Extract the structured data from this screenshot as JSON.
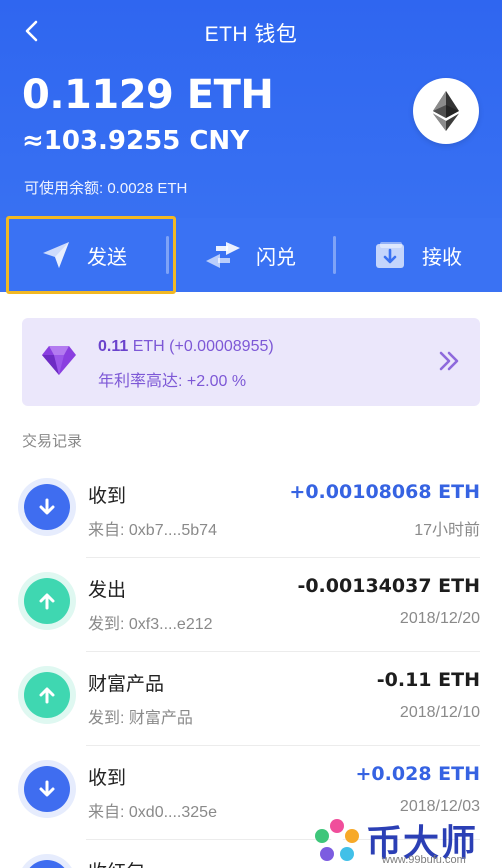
{
  "nav": {
    "title": "ETH 钱包"
  },
  "wallet": {
    "balance": "0.1129 ETH",
    "cny": "≈103.9255 CNY",
    "available": "可使用余额: 0.0028 ETH"
  },
  "actions": [
    {
      "label": "发送",
      "icon": "send-icon"
    },
    {
      "label": "闪兑",
      "icon": "swap-icon"
    },
    {
      "label": "接收",
      "icon": "receive-icon"
    }
  ],
  "promo": {
    "amount": "0.11",
    "unit": " ETH (+0.00008955)",
    "rate": "年利率高达: +2.00 %",
    "icon": "diamond-icon"
  },
  "section_title": "交易记录",
  "transactions": [
    {
      "type": "收到",
      "addr": "来自: 0xb7....5b74",
      "amount": "+0.00108068 ETH",
      "time": "17小时前",
      "direction": "in"
    },
    {
      "type": "发出",
      "addr": "发到: 0xf3....e212",
      "amount": "-0.00134037 ETH",
      "time": "2018/12/20",
      "direction": "out"
    },
    {
      "type": "财富产品",
      "addr": "发到: 财富产品",
      "amount": "-0.11 ETH",
      "time": "2018/12/10",
      "direction": "out"
    },
    {
      "type": "收到",
      "addr": "来自: 0xd0....325e",
      "amount": "+0.028 ETH",
      "time": "2018/12/03",
      "direction": "in"
    },
    {
      "type": "收红包",
      "addr": "",
      "amount": "",
      "time": "",
      "direction": "in"
    }
  ],
  "watermark": {
    "text": "币大师",
    "url": "www.99bufu.com"
  },
  "colors": {
    "primary": "#2f66f0",
    "highlight": "#f2b823",
    "promo": "#7d58d6",
    "in": "#3f6df0",
    "out": "#3fd7b1"
  }
}
